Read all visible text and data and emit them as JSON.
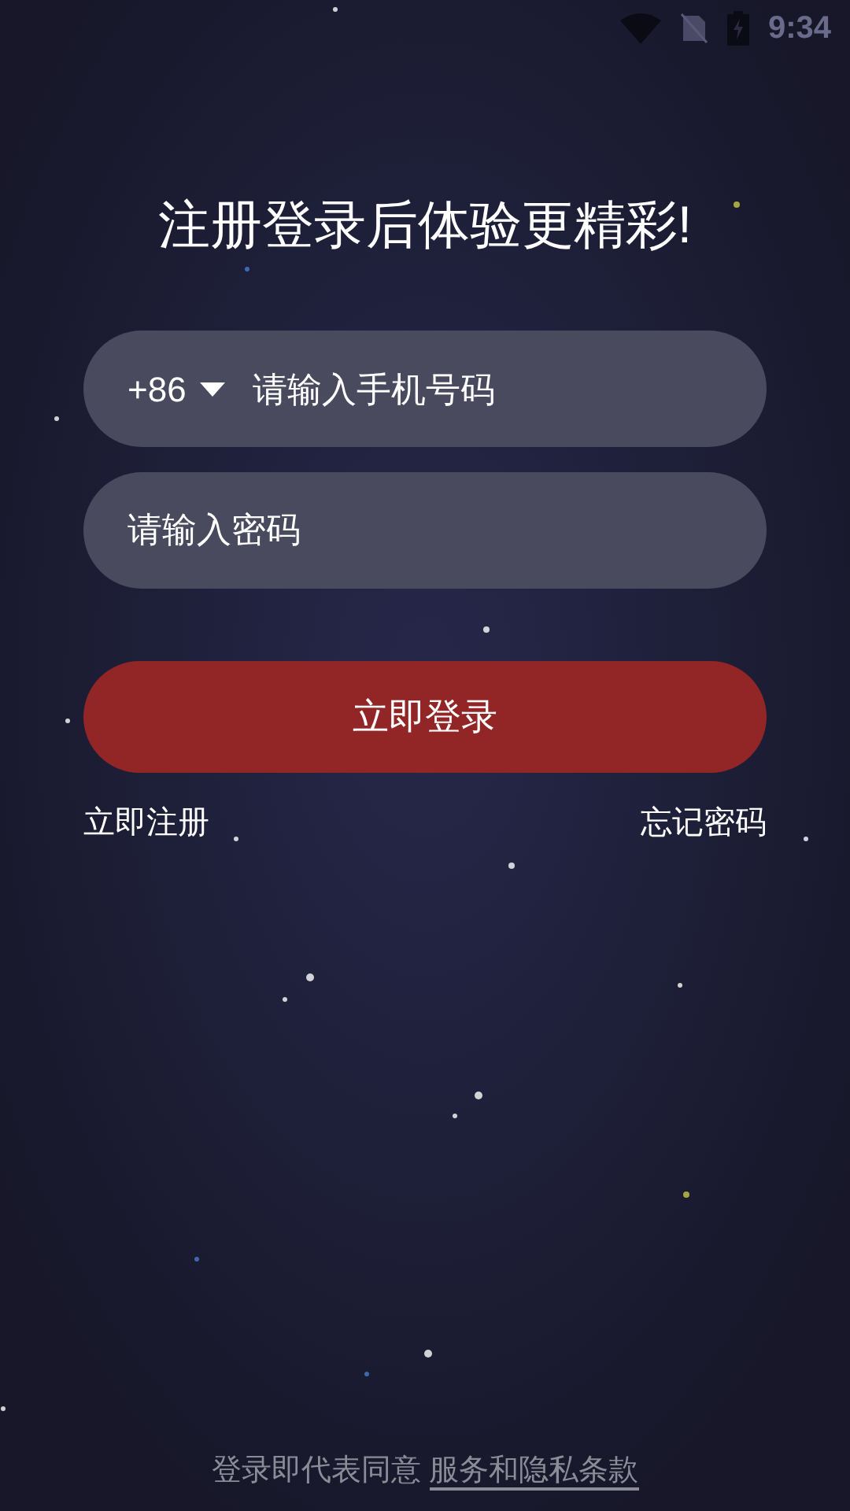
{
  "status_bar": {
    "time": "9:34"
  },
  "title": "注册登录后体验更精彩!",
  "phone_field": {
    "country_code": "+86",
    "placeholder": "请输入手机号码"
  },
  "password_field": {
    "placeholder": "请输入密码"
  },
  "login_button": "立即登录",
  "links": {
    "register": "立即注册",
    "forgot": "忘记密码"
  },
  "footer": {
    "text": "登录即代表同意",
    "link": "服务和隐私条款"
  }
}
